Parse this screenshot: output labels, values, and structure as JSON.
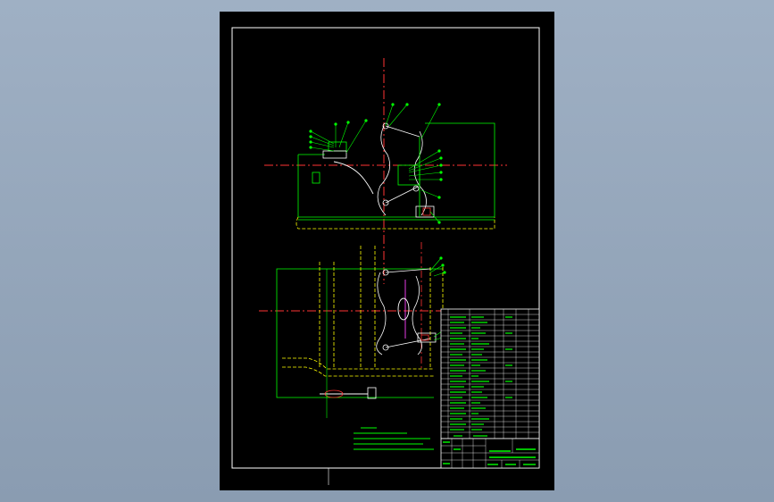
{
  "viewer": {
    "background_top": "#9fb0c4",
    "background_bottom": "#8a9cb1"
  },
  "drawing": {
    "paper_color": "#000000",
    "frame_color": "#ffffff",
    "line_color": "#00ff00",
    "centerline_color": "#ff3333",
    "hidden_line_color": "#ffff00",
    "pivot_color": "#ffffff",
    "accent_color": "#ff44ff"
  }
}
